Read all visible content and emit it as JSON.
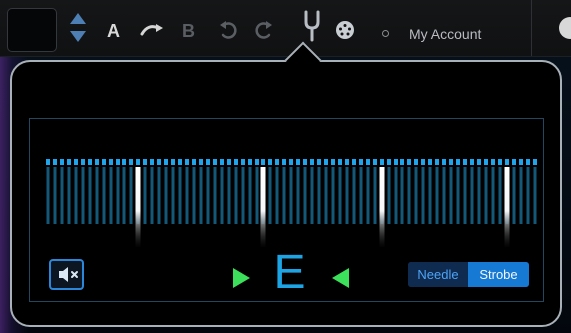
{
  "toolbar": {
    "a_label": "A",
    "b_label": "B",
    "account_label": "My Account"
  },
  "tuner": {
    "note": "E",
    "mode_options": [
      {
        "label": "Needle",
        "selected": false
      },
      {
        "label": "Strobe",
        "selected": true
      }
    ]
  },
  "colors": {
    "accent": "#1da4e5",
    "arrow": "#3ce05a",
    "toggle_selected": "#1679d4",
    "toggle_unselected": "#0f2c50"
  },
  "icons": {
    "tuning_fork": "tuning-fork-icon",
    "metronome": "metronome-icon",
    "undo": "undo-icon",
    "redo": "redo-icon",
    "mute": "mute-icon",
    "sort": "sort-arrows-icon",
    "loop": "loop-icon"
  }
}
